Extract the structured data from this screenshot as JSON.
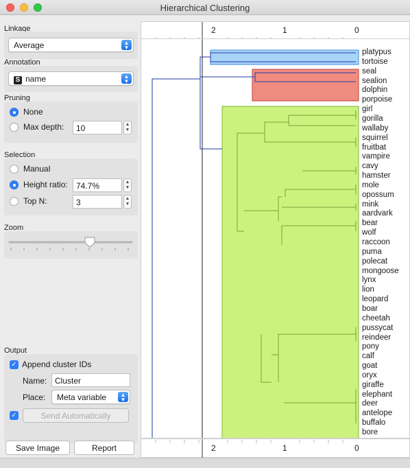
{
  "window": {
    "title": "Hierarchical Clustering"
  },
  "linkage": {
    "label": "Linkage",
    "value": "Average"
  },
  "annotation": {
    "label": "Annotation",
    "badge": "S",
    "value": "name"
  },
  "pruning": {
    "label": "Pruning",
    "none_label": "None",
    "max_depth_label": "Max depth:",
    "max_depth_value": "10",
    "selected": "none"
  },
  "selection": {
    "label": "Selection",
    "manual_label": "Manual",
    "height_ratio_label": "Height ratio:",
    "height_ratio_value": "74.7%",
    "top_n_label": "Top N:",
    "top_n_value": "3",
    "selected": "height_ratio"
  },
  "zoom": {
    "label": "Zoom",
    "level": 0.65
  },
  "output": {
    "label": "Output",
    "append_label": "Append cluster IDs",
    "append_checked": true,
    "name_label": "Name:",
    "name_value": "Cluster",
    "place_label": "Place:",
    "place_value": "Meta variable",
    "send_label": "Send Automatically",
    "send_checked": true
  },
  "buttons": {
    "save_image": "Save Image",
    "report": "Report"
  },
  "axis": {
    "ticks": [
      "2",
      "1",
      "0"
    ],
    "cut_height": 1.67
  },
  "leaves": [
    "platypus",
    "tortoise",
    "seal",
    "sealion",
    "dolphin",
    "porpoise",
    "girl",
    "gorilla",
    "wallaby",
    "squirrel",
    "fruitbat",
    "vampire",
    "cavy",
    "hamster",
    "mole",
    "opossum",
    "mink",
    "aardvark",
    "bear",
    "wolf",
    "raccoon",
    "puma",
    "polecat",
    "mongoose",
    "lynx",
    "lion",
    "leopard",
    "boar",
    "cheetah",
    "pussycat",
    "reindeer",
    "pony",
    "calf",
    "goat",
    "oryx",
    "giraffe",
    "elephant",
    "deer",
    "antelope",
    "buffalo",
    "bore"
  ],
  "colors": {
    "cluster1": "#a8d4f8",
    "cluster2": "#f08b7f",
    "cluster3": "#ccf27e",
    "tree_line": "#1f3aa8"
  }
}
